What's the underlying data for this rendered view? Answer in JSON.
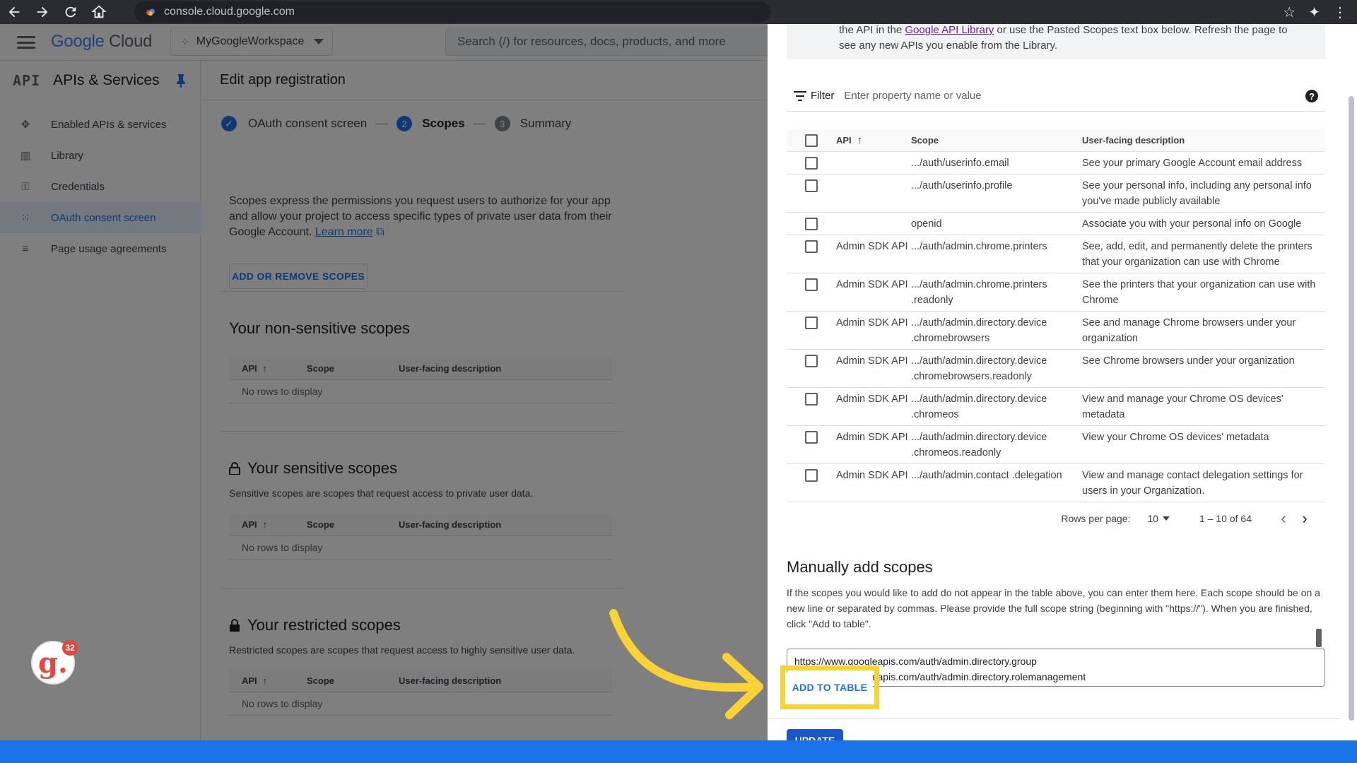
{
  "browser": {
    "url": "console.cloud.google.com"
  },
  "header": {
    "logo_google": "Google",
    "logo_cloud": "Cloud",
    "project": "MyGoogleWorkspace",
    "search_placeholder": "Search (/) for resources, docs, products, and more"
  },
  "sidebar": {
    "badge": "API",
    "title": "APIs & Services",
    "items": [
      {
        "label": "Enabled APIs & services"
      },
      {
        "label": "Library"
      },
      {
        "label": "Credentials"
      },
      {
        "label": "OAuth consent screen"
      },
      {
        "label": "Page usage agreements"
      }
    ]
  },
  "main": {
    "title": "Edit app registration",
    "steps": [
      {
        "label": "OAuth consent screen"
      },
      {
        "num": "2",
        "label": "Scopes"
      },
      {
        "num": "3",
        "label": "Summary"
      }
    ],
    "intro": "Scopes express the permissions you request users to authorize for your app and allow your project to access specific types of private user data from their Google Account.",
    "learn_more": "Learn more",
    "add_remove_button": "ADD OR REMOVE SCOPES",
    "table_headers": {
      "api": "API",
      "scope": "Scope",
      "desc": "User-facing description"
    },
    "no_rows": "No rows to display",
    "non_sensitive_title": "Your non-sensitive scopes",
    "sensitive_title": "Your sensitive scopes",
    "sensitive_desc": "Sensitive scopes are scopes that request access to private user data.",
    "restricted_title": "Your restricted scopes",
    "restricted_desc": "Restricted scopes are scopes that request access to highly sensitive user data."
  },
  "fab": {
    "letter": "g.",
    "badge": "32"
  },
  "panel": {
    "info_pre": "the API in the ",
    "info_link": "Google API Library",
    "info_post": " or use the Pasted Scopes text box below. Refresh the page to see any new APIs you enable from the Library.",
    "filter_label": "Filter",
    "filter_placeholder": "Enter property name or value",
    "headers": {
      "api": "API",
      "scope": "Scope",
      "desc": "User-facing description"
    },
    "rows": [
      {
        "api": "",
        "scope": ".../auth/userinfo.email",
        "desc": "See your primary Google Account email address"
      },
      {
        "api": "",
        "scope": ".../auth/userinfo.profile",
        "desc": "See your personal info, including any personal info you've made publicly available"
      },
      {
        "api": "",
        "scope": "openid",
        "desc": "Associate you with your personal info on Google"
      },
      {
        "api": "Admin SDK API",
        "scope": ".../auth/admin.chrome.printers",
        "desc": "See, add, edit, and permanently delete the printers that your organization can use with Chrome"
      },
      {
        "api": "Admin SDK API",
        "scope": ".../auth/admin.chrome.printers .readonly",
        "desc": "See the printers that your organization can use with Chrome"
      },
      {
        "api": "Admin SDK API",
        "scope": ".../auth/admin.directory.device .chromebrowsers",
        "desc": "See and manage Chrome browsers under your organization"
      },
      {
        "api": "Admin SDK API",
        "scope": ".../auth/admin.directory.device .chromebrowsers.readonly",
        "desc": "See Chrome browsers under your organization"
      },
      {
        "api": "Admin SDK API",
        "scope": ".../auth/admin.directory.device .chromeos",
        "desc": "View and manage your Chrome OS devices' metadata"
      },
      {
        "api": "Admin SDK API",
        "scope": ".../auth/admin.directory.device .chromeos.readonly",
        "desc": "View your Chrome OS devices' metadata"
      },
      {
        "api": "Admin SDK API",
        "scope": ".../auth/admin.contact .delegation",
        "desc": "View and manage contact delegation settings for users in your Organization."
      }
    ],
    "rows_per_page_label": "Rows per page:",
    "rows_per_page": "10",
    "range": "1 – 10 of 64",
    "manual_title": "Manually add scopes",
    "manual_desc": "If the scopes you would like to add do not appear in the table above, you can enter them here. Each scope should be on a new line or separated by commas. Please provide the full scope string (beginning with \"https://\"). When you are finished, click \"Add to table\".",
    "textarea_value": "https://www.googleapis.com/auth/admin.directory.group\nhttps://www.googleapis.com/auth/admin.directory.rolemanagement",
    "add_button": "ADD TO TABLE",
    "update_button": "UPDATE"
  },
  "colors": {
    "accent": "#1a73e8",
    "highlight": "#f9d236"
  }
}
